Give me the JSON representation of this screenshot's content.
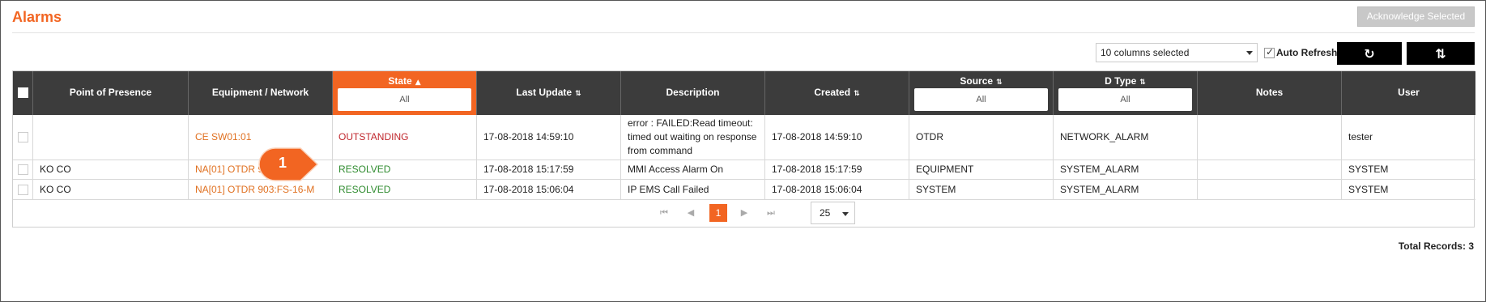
{
  "header": {
    "title": "Alarms",
    "acknowledge_label": "Acknowledge Selected"
  },
  "toolbar": {
    "columns_select_value": "10 columns selected",
    "auto_refresh_label": "Auto Refresh",
    "auto_refresh_checked": true,
    "refresh_icon": "refresh-icon",
    "sort_icon": "sort-toggle-icon"
  },
  "table": {
    "columns": [
      {
        "label": ""
      },
      {
        "label": "Point of Presence"
      },
      {
        "label": "Equipment / Network"
      },
      {
        "label": "State",
        "sort": "▲",
        "filter": "All",
        "active": true
      },
      {
        "label": "Last Update",
        "sort": "⇅"
      },
      {
        "label": "Description"
      },
      {
        "label": "Created",
        "sort": "⇅"
      },
      {
        "label": "Source",
        "sort": "⇅",
        "filter": "All"
      },
      {
        "label": "D Type",
        "sort": "⇅",
        "filter": "All"
      },
      {
        "label": "Notes"
      },
      {
        "label": "User"
      }
    ],
    "rows": [
      {
        "pop": "",
        "equipment": "CE SW01:01",
        "state": "OUTSTANDING",
        "last_update": "17-08-2018 14:59:10",
        "description": "error : FAILED:Read timeout: timed out waiting on response from command",
        "created": "17-08-2018 14:59:10",
        "source": "OTDR",
        "dtype": "NETWORK_ALARM",
        "notes": "",
        "user": "tester"
      },
      {
        "pop": "KO CO",
        "equipment": "NA[01] OTDR 903",
        "state": "RESOLVED",
        "last_update": "17-08-2018 15:17:59",
        "description": "MMI Access Alarm On",
        "created": "17-08-2018 15:17:59",
        "source": "EQUIPMENT",
        "dtype": "SYSTEM_ALARM",
        "notes": "",
        "user": "SYSTEM"
      },
      {
        "pop": "KO CO",
        "equipment": "NA[01] OTDR 903:FS-16-M",
        "state": "RESOLVED",
        "last_update": "17-08-2018 15:06:04",
        "description": "IP EMS Call Failed",
        "created": "17-08-2018 15:06:04",
        "source": "SYSTEM",
        "dtype": "SYSTEM_ALARM",
        "notes": "",
        "user": "SYSTEM"
      }
    ]
  },
  "pager": {
    "current_page": "1",
    "page_size": "25",
    "first_icon": "⏮",
    "prev_icon": "◀",
    "next_icon": "▶",
    "last_icon": "⏭"
  },
  "footer": {
    "total_records": "Total Records: 3"
  },
  "callout": {
    "number": "1"
  },
  "colors": {
    "accent": "#f26522",
    "header_bg": "#3c3c3c",
    "outstanding": "#c0262c",
    "resolved": "#2e8b2e",
    "link": "#e07020"
  }
}
